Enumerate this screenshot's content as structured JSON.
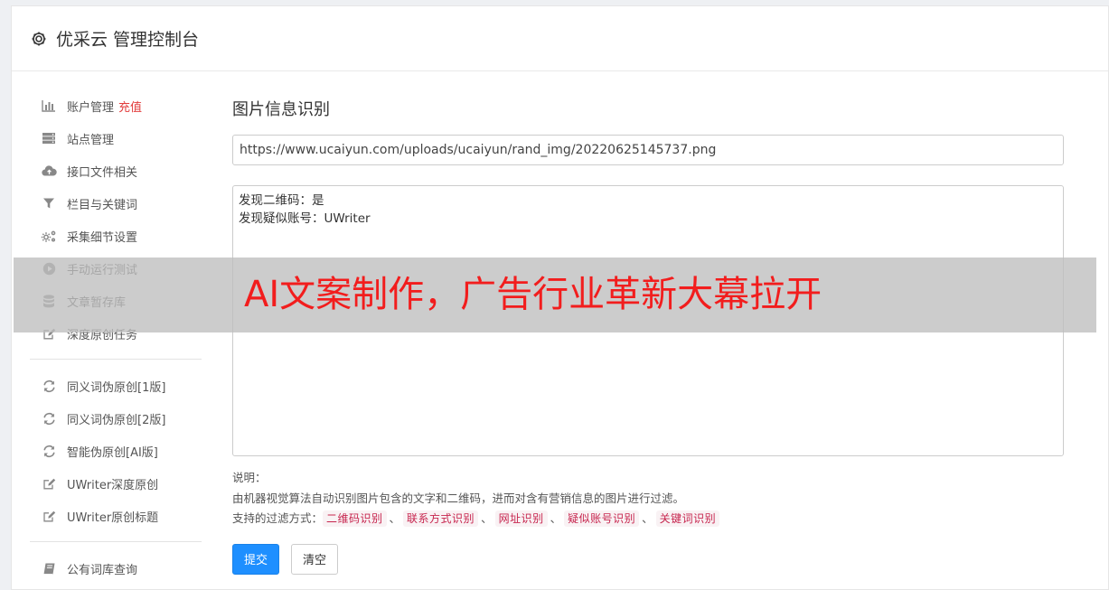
{
  "header": {
    "title": "优采云 管理控制台",
    "icon": "gear-icon"
  },
  "sidebar": {
    "group1": [
      {
        "label": "账户管理",
        "badge": "充值",
        "icon": "bar-chart-icon"
      },
      {
        "label": "站点管理",
        "icon": "server-icon"
      },
      {
        "label": "接口文件相关",
        "icon": "cloud-upload-icon"
      },
      {
        "label": "栏目与关键词",
        "icon": "filter-icon"
      },
      {
        "label": "采集细节设置",
        "icon": "cogs-icon"
      },
      {
        "label": "手动运行测试",
        "icon": "play-icon"
      },
      {
        "label": "文章暂存库",
        "icon": "database-icon"
      },
      {
        "label": "深度原创任务",
        "icon": "edit-icon"
      }
    ],
    "group2": [
      {
        "label": "同义词伪原创[1版]",
        "icon": "refresh-icon"
      },
      {
        "label": "同义词伪原创[2版]",
        "icon": "refresh-icon"
      },
      {
        "label": "智能伪原创[AI版]",
        "icon": "refresh-icon"
      },
      {
        "label": "UWriter深度原创",
        "icon": "edit-icon"
      },
      {
        "label": "UWriter原创标题",
        "icon": "edit-icon"
      }
    ],
    "group3": [
      {
        "label": "公有词库查询",
        "icon": "book-icon"
      }
    ]
  },
  "main": {
    "title": "图片信息识别",
    "url_value": "https://www.ucaiyun.com/uploads/ucaiyun/rand_img/20220625145737.png",
    "result_lines": [
      "发现二维码：是",
      "发现疑似账号：UWriter"
    ],
    "desc_heading": "说明：",
    "desc_text": "由机器视觉算法自动识别图片包含的文字和二维码，进而对含有营销信息的图片进行过滤。",
    "filter_label": "支持的过滤方式：",
    "filters": [
      "二维码识别",
      "联系方式识别",
      "网址识别",
      "疑似账号识别",
      "关键词识别"
    ],
    "separator": "、",
    "submit_label": "提交",
    "clear_label": "清空"
  },
  "overlay": {
    "text": "AI文案制作，广告行业革新大幕拉开"
  },
  "colors": {
    "primary": "#1e8fff",
    "badge": "#e23c3c",
    "tag_text": "#c7254e",
    "tag_bg": "#f9f2f4",
    "overlay_text": "#f21d1d"
  }
}
